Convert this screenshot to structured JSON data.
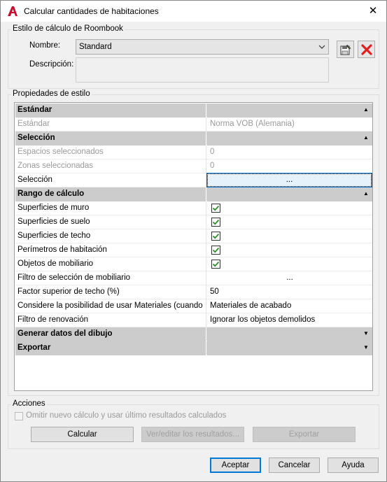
{
  "window": {
    "title": "Calcular cantidades de habitaciones",
    "close_glyph": "✕",
    "app_icon": "autocad-a-icon"
  },
  "style_group": {
    "label": "Estilo de cálculo de Roombook",
    "name_label": "Nombre:",
    "name_value": "Standard",
    "desc_label": "Descripción:",
    "desc_value": "",
    "edit_icon": "edit-style-icon",
    "delete_icon": "delete-icon"
  },
  "props_group": {
    "label": "Propiedades de estilo"
  },
  "grid": {
    "rows": [
      {
        "type": "category",
        "name": "Estándar",
        "value": "",
        "arrow": "▲"
      },
      {
        "type": "disabled",
        "name": "Estándar",
        "value": "Norma VOB (Alemania)"
      },
      {
        "type": "category",
        "name": "Selección",
        "value": "",
        "arrow": "▲"
      },
      {
        "type": "disabled",
        "name": "Espacios seleccionados",
        "value": "0"
      },
      {
        "type": "disabled",
        "name": "Zonas seleccionadas",
        "value": "0"
      },
      {
        "type": "button",
        "name": "Selección",
        "value": "..."
      },
      {
        "type": "category",
        "name": "Rango de cálculo",
        "value": "",
        "arrow": "▲"
      },
      {
        "type": "check",
        "name": "Superficies de muro",
        "checked": true
      },
      {
        "type": "check",
        "name": "Superficies de suelo",
        "checked": true
      },
      {
        "type": "check",
        "name": "Superficies de techo",
        "checked": true
      },
      {
        "type": "check",
        "name": "Perímetros de habitación",
        "checked": true
      },
      {
        "type": "check",
        "name": "Objetos de mobiliario",
        "checked": true
      },
      {
        "type": "ellipsis",
        "name": "Filtro de selección de mobiliario",
        "value": "..."
      },
      {
        "type": "text",
        "name": "Factor superior de techo (%)",
        "value": "50"
      },
      {
        "type": "text",
        "name": "Considere la posibilidad de usar Materiales (cuando",
        "value": "Materiales de acabado"
      },
      {
        "type": "text",
        "name": "Filtro de renovación",
        "value": "Ignorar los objetos demolidos"
      },
      {
        "type": "category",
        "name": "Generar datos del dibujo",
        "value": "",
        "arrow": "▼"
      },
      {
        "type": "category",
        "name": "Exportar",
        "value": "",
        "arrow": "▼"
      }
    ]
  },
  "actions_group": {
    "label": "Acciones",
    "checkbox_label": "Omitir nuevo cálculo y usar último resultados calculados",
    "calc_button": "Calcular",
    "view_button": "Ver/editar los resultados...",
    "export_button": "Exportar"
  },
  "footer": {
    "ok_button": "Aceptar",
    "cancel_button": "Cancelar",
    "help_button": "Ayuda"
  },
  "colors": {
    "accent": "#0078d7",
    "check": "#2e8b2e",
    "delete": "#e02020",
    "app_icon": "#c8102e"
  }
}
